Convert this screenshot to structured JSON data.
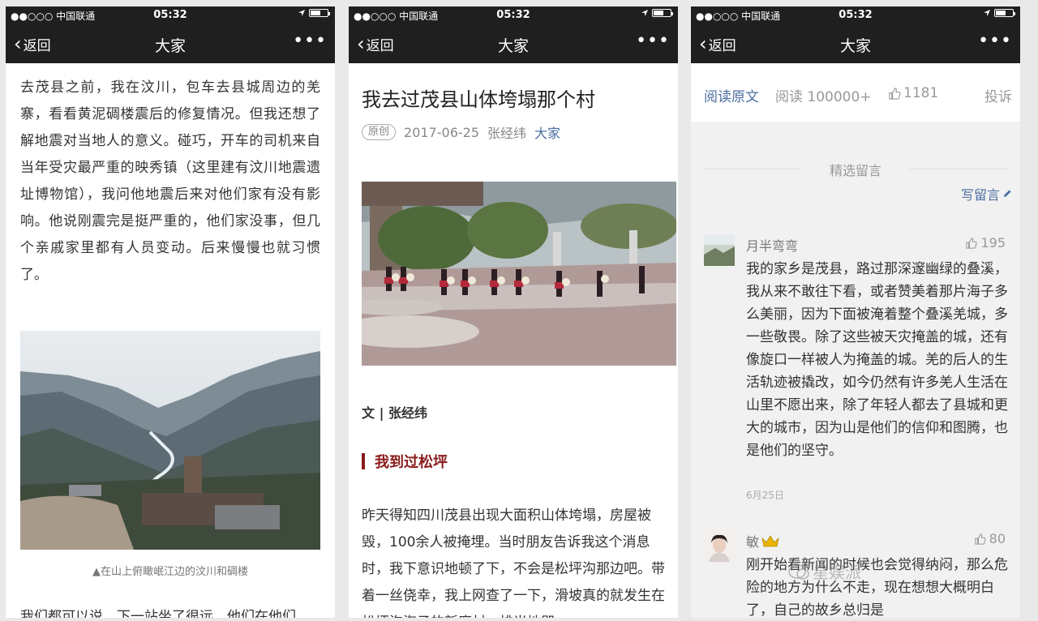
{
  "status": {
    "carrier": "●●○○○ 中国联通",
    "time": "05:32"
  },
  "nav": {
    "back_label": "返回",
    "title": "大家",
    "more": "•••"
  },
  "screen1": {
    "paragraph": "去茂县之前，我在汶川，包车去县城周边的羌寨，看看黄泥碉楼震后的修复情况。但我还想了解地震对当地人的意义。碰巧，开车的司机来自当年受灾最严重的映秀镇（这里建有汶川地震遗址博物馆），我问他地震后来对他们家有没有影响。他说刚震完是挺严重的，他们家没事，但几个亲戚家里都有人员变动。后来慢慢也就习惯了。",
    "caption": "▲在山上俯瞰岷江边的汶川和碉楼",
    "cut_line": "我们都可以说，下一站坐了很远，他们在他们"
  },
  "screen2": {
    "title": "我去过茂县山体垮塌那个村",
    "tag": "原创",
    "date": "2017-06-25",
    "author": "张经纬",
    "account": "大家",
    "byline": "文 | 张经纬",
    "section": "我到过松坪",
    "paragraph": "昨天得知四川茂县出现大面积山体垮塌，房屋被毁，100余人被掩埋。当时朋友告诉我这个消息时，我下意识地顿了下，不会是松坪沟那边吧。带着一丝侥幸，我上网查了一下，滑坡真的就发生在松坪沟海子的新磨村，排当地即"
  },
  "screen3": {
    "read_original": "阅读原文",
    "read_count": "阅读 100000+",
    "likes": "1181",
    "report": "投诉",
    "selected_header": "精选留言",
    "write_comment": "写留言",
    "comments": [
      {
        "name": "月半弯弯",
        "likes": "195",
        "text": "我的家乡是茂县，路过那深邃幽绿的叠溪，我从来不敢往下看，或者赞美着那片海子多么美丽，因为下面被淹着整个叠溪羌城，多一些敬畏。除了这些被天灾掩盖的城，还有像旋口一样被人为掩盖的城。羌的后人的生活轨迹被撬改，如今仍然有许多羌人生活在山里不愿出来，除了年轻人都去了县城和更大的城市，因为山是他们的信仰和图腾，也是他们的坚守。",
        "date": "6月25日"
      },
      {
        "name": "敏",
        "likes": "80",
        "text": "刚开始看新闻的时候也会觉得纳闷，那么危险的地方为什么不走，现在想想大概明白了，自己的故乡总归是"
      }
    ],
    "watermark": "星娱派"
  },
  "colors": {
    "accent": "#4c6fa0",
    "section_red": "#8b1b1b",
    "bar_bg": "#1f1f1f"
  },
  "icons": [
    "wifi-icon",
    "location-icon",
    "battery-icon",
    "back-chevron-icon",
    "more-icon",
    "thumb-up-icon",
    "pencil-icon",
    "crown-icon"
  ]
}
